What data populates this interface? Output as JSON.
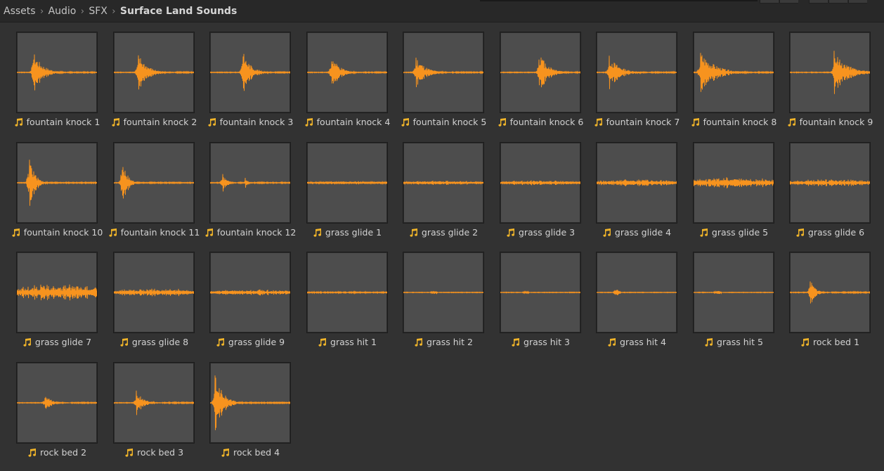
{
  "breadcrumb": {
    "items": [
      "Assets",
      "Audio",
      "SFX",
      "Surface Land Sounds"
    ]
  },
  "colors": {
    "waveform": "#f7931e",
    "audio_icon": "#f0b429"
  },
  "assets": [
    {
      "name": "fountain knock 1",
      "wave": {
        "type": "impact",
        "peak": 0.2,
        "amp": 0.55,
        "len": 0.35
      }
    },
    {
      "name": "fountain knock 2",
      "wave": {
        "type": "impact",
        "peak": 0.3,
        "amp": 0.5,
        "len": 0.35
      }
    },
    {
      "name": "fountain knock 3",
      "wave": {
        "type": "impact",
        "peak": 0.4,
        "amp": 0.6,
        "len": 0.3
      }
    },
    {
      "name": "fountain knock 4",
      "wave": {
        "type": "impact",
        "peak": 0.3,
        "amp": 0.45,
        "len": 0.3
      }
    },
    {
      "name": "fountain knock 5",
      "wave": {
        "type": "impact",
        "peak": 0.15,
        "amp": 0.45,
        "len": 0.35
      }
    },
    {
      "name": "fountain knock 6",
      "wave": {
        "type": "impact",
        "peak": 0.48,
        "amp": 0.55,
        "len": 0.35
      }
    },
    {
      "name": "fountain knock 7",
      "wave": {
        "type": "impact",
        "peak": 0.15,
        "amp": 0.45,
        "len": 0.4
      }
    },
    {
      "name": "fountain knock 8",
      "wave": {
        "type": "impact",
        "peak": 0.08,
        "amp": 0.55,
        "len": 0.55
      }
    },
    {
      "name": "fountain knock 9",
      "wave": {
        "type": "impact",
        "peak": 0.55,
        "amp": 0.55,
        "len": 0.5
      }
    },
    {
      "name": "fountain knock 10",
      "wave": {
        "type": "impact",
        "peak": 0.15,
        "amp": 0.8,
        "len": 0.2
      }
    },
    {
      "name": "fountain knock 11",
      "wave": {
        "type": "impact",
        "peak": 0.1,
        "amp": 0.75,
        "len": 0.18
      }
    },
    {
      "name": "fountain knock 12",
      "wave": {
        "type": "double",
        "peak": 0.15,
        "amp": 0.28,
        "len": 0.15
      }
    },
    {
      "name": "grass glide 1",
      "wave": {
        "type": "noise",
        "amp": 0.04
      }
    },
    {
      "name": "grass glide 2",
      "wave": {
        "type": "noise",
        "amp": 0.05
      }
    },
    {
      "name": "grass glide 3",
      "wave": {
        "type": "noise",
        "amp": 0.06
      }
    },
    {
      "name": "grass glide 4",
      "wave": {
        "type": "noise",
        "amp": 0.09
      }
    },
    {
      "name": "grass glide 5",
      "wave": {
        "type": "noise",
        "amp": 0.14
      }
    },
    {
      "name": "grass glide 6",
      "wave": {
        "type": "noise",
        "amp": 0.09
      }
    },
    {
      "name": "grass glide 7",
      "wave": {
        "type": "noise",
        "amp": 0.2
      }
    },
    {
      "name": "grass glide 8",
      "wave": {
        "type": "noise",
        "amp": 0.1
      }
    },
    {
      "name": "grass glide 9",
      "wave": {
        "type": "noise",
        "amp": 0.07
      }
    },
    {
      "name": "grass hit 1",
      "wave": {
        "type": "flat",
        "amp": 0.02
      }
    },
    {
      "name": "grass hit 2",
      "wave": {
        "type": "blip",
        "peak": 0.38,
        "amp": 0.05
      }
    },
    {
      "name": "grass hit 3",
      "wave": {
        "type": "blip",
        "peak": 0.32,
        "amp": 0.03
      }
    },
    {
      "name": "grass hit 4",
      "wave": {
        "type": "blip",
        "peak": 0.25,
        "amp": 0.09
      }
    },
    {
      "name": "grass hit 5",
      "wave": {
        "type": "blip",
        "peak": 0.3,
        "amp": 0.07
      }
    },
    {
      "name": "rock bed 1",
      "wave": {
        "type": "impact",
        "peak": 0.25,
        "amp": 0.35,
        "len": 0.2
      }
    },
    {
      "name": "rock bed 2",
      "wave": {
        "type": "impact",
        "peak": 0.35,
        "amp": 0.22,
        "len": 0.25
      }
    },
    {
      "name": "rock bed 3",
      "wave": {
        "type": "impact",
        "peak": 0.28,
        "amp": 0.32,
        "len": 0.25
      }
    },
    {
      "name": "rock bed 4",
      "wave": {
        "type": "impact",
        "peak": 0.06,
        "amp": 0.75,
        "len": 0.3
      }
    }
  ]
}
